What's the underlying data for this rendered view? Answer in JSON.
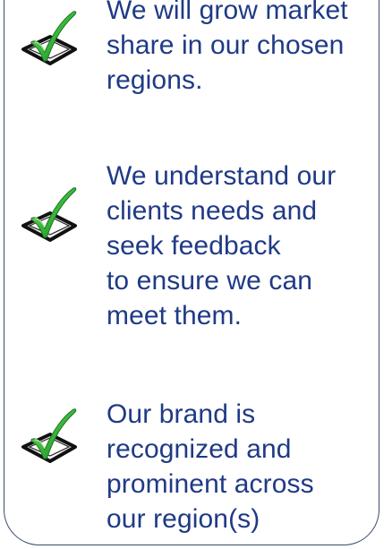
{
  "items": [
    {
      "icon": "checkbox-check-icon",
      "text": "We will grow market\nshare in our chosen\nregions."
    },
    {
      "icon": "checkbox-check-icon",
      "text": "We understand our\nclients needs and\nseek feedback\nto ensure we can\nmeet them."
    },
    {
      "icon": "checkbox-check-icon",
      "text": "Our brand is\nrecognized and\nprominent across\nour region(s)"
    }
  ],
  "colors": {
    "text": "#1f3a86",
    "border": "#3b4a6b",
    "check_green": "#35b83a"
  }
}
